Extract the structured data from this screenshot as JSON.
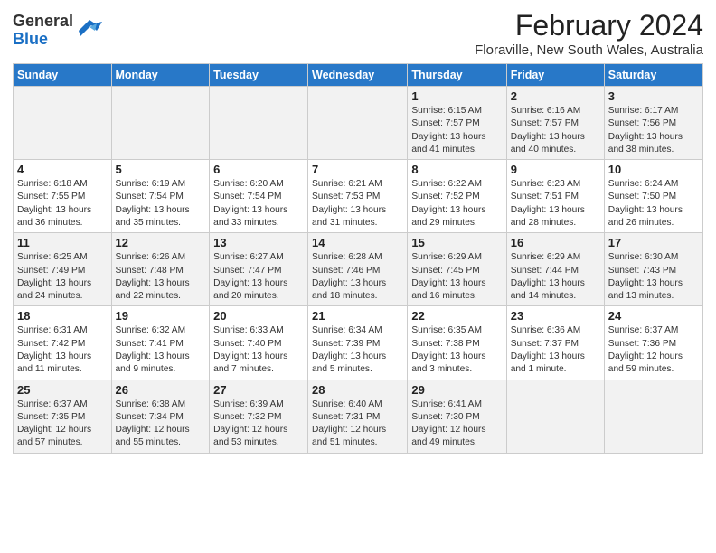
{
  "logo": {
    "general": "General",
    "blue": "Blue"
  },
  "title": "February 2024",
  "subtitle": "Floraville, New South Wales, Australia",
  "days_of_week": [
    "Sunday",
    "Monday",
    "Tuesday",
    "Wednesday",
    "Thursday",
    "Friday",
    "Saturday"
  ],
  "weeks": [
    [
      {
        "day": "",
        "info": ""
      },
      {
        "day": "",
        "info": ""
      },
      {
        "day": "",
        "info": ""
      },
      {
        "day": "",
        "info": ""
      },
      {
        "day": "1",
        "info": "Sunrise: 6:15 AM\nSunset: 7:57 PM\nDaylight: 13 hours and 41 minutes."
      },
      {
        "day": "2",
        "info": "Sunrise: 6:16 AM\nSunset: 7:57 PM\nDaylight: 13 hours and 40 minutes."
      },
      {
        "day": "3",
        "info": "Sunrise: 6:17 AM\nSunset: 7:56 PM\nDaylight: 13 hours and 38 minutes."
      }
    ],
    [
      {
        "day": "4",
        "info": "Sunrise: 6:18 AM\nSunset: 7:55 PM\nDaylight: 13 hours and 36 minutes."
      },
      {
        "day": "5",
        "info": "Sunrise: 6:19 AM\nSunset: 7:54 PM\nDaylight: 13 hours and 35 minutes."
      },
      {
        "day": "6",
        "info": "Sunrise: 6:20 AM\nSunset: 7:54 PM\nDaylight: 13 hours and 33 minutes."
      },
      {
        "day": "7",
        "info": "Sunrise: 6:21 AM\nSunset: 7:53 PM\nDaylight: 13 hours and 31 minutes."
      },
      {
        "day": "8",
        "info": "Sunrise: 6:22 AM\nSunset: 7:52 PM\nDaylight: 13 hours and 29 minutes."
      },
      {
        "day": "9",
        "info": "Sunrise: 6:23 AM\nSunset: 7:51 PM\nDaylight: 13 hours and 28 minutes."
      },
      {
        "day": "10",
        "info": "Sunrise: 6:24 AM\nSunset: 7:50 PM\nDaylight: 13 hours and 26 minutes."
      }
    ],
    [
      {
        "day": "11",
        "info": "Sunrise: 6:25 AM\nSunset: 7:49 PM\nDaylight: 13 hours and 24 minutes."
      },
      {
        "day": "12",
        "info": "Sunrise: 6:26 AM\nSunset: 7:48 PM\nDaylight: 13 hours and 22 minutes."
      },
      {
        "day": "13",
        "info": "Sunrise: 6:27 AM\nSunset: 7:47 PM\nDaylight: 13 hours and 20 minutes."
      },
      {
        "day": "14",
        "info": "Sunrise: 6:28 AM\nSunset: 7:46 PM\nDaylight: 13 hours and 18 minutes."
      },
      {
        "day": "15",
        "info": "Sunrise: 6:29 AM\nSunset: 7:45 PM\nDaylight: 13 hours and 16 minutes."
      },
      {
        "day": "16",
        "info": "Sunrise: 6:29 AM\nSunset: 7:44 PM\nDaylight: 13 hours and 14 minutes."
      },
      {
        "day": "17",
        "info": "Sunrise: 6:30 AM\nSunset: 7:43 PM\nDaylight: 13 hours and 13 minutes."
      }
    ],
    [
      {
        "day": "18",
        "info": "Sunrise: 6:31 AM\nSunset: 7:42 PM\nDaylight: 13 hours and 11 minutes."
      },
      {
        "day": "19",
        "info": "Sunrise: 6:32 AM\nSunset: 7:41 PM\nDaylight: 13 hours and 9 minutes."
      },
      {
        "day": "20",
        "info": "Sunrise: 6:33 AM\nSunset: 7:40 PM\nDaylight: 13 hours and 7 minutes."
      },
      {
        "day": "21",
        "info": "Sunrise: 6:34 AM\nSunset: 7:39 PM\nDaylight: 13 hours and 5 minutes."
      },
      {
        "day": "22",
        "info": "Sunrise: 6:35 AM\nSunset: 7:38 PM\nDaylight: 13 hours and 3 minutes."
      },
      {
        "day": "23",
        "info": "Sunrise: 6:36 AM\nSunset: 7:37 PM\nDaylight: 13 hours and 1 minute."
      },
      {
        "day": "24",
        "info": "Sunrise: 6:37 AM\nSunset: 7:36 PM\nDaylight: 12 hours and 59 minutes."
      }
    ],
    [
      {
        "day": "25",
        "info": "Sunrise: 6:37 AM\nSunset: 7:35 PM\nDaylight: 12 hours and 57 minutes."
      },
      {
        "day": "26",
        "info": "Sunrise: 6:38 AM\nSunset: 7:34 PM\nDaylight: 12 hours and 55 minutes."
      },
      {
        "day": "27",
        "info": "Sunrise: 6:39 AM\nSunset: 7:32 PM\nDaylight: 12 hours and 53 minutes."
      },
      {
        "day": "28",
        "info": "Sunrise: 6:40 AM\nSunset: 7:31 PM\nDaylight: 12 hours and 51 minutes."
      },
      {
        "day": "29",
        "info": "Sunrise: 6:41 AM\nSunset: 7:30 PM\nDaylight: 12 hours and 49 minutes."
      },
      {
        "day": "",
        "info": ""
      },
      {
        "day": "",
        "info": ""
      }
    ]
  ]
}
